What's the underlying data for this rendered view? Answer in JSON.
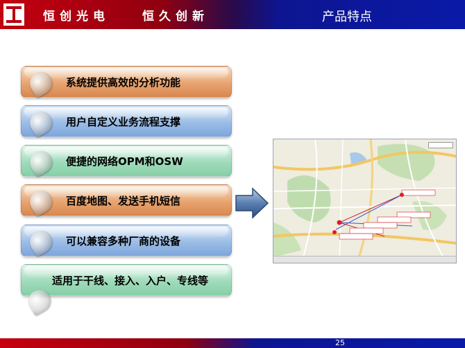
{
  "header": {
    "brand": "恒创光电",
    "slogan": "恒久创新",
    "title": "产品特点"
  },
  "features": [
    {
      "label": "系统提供高效的分析功能",
      "color": "orange"
    },
    {
      "label": "用户自定义业务流程支撑",
      "color": "blue"
    },
    {
      "label": "便捷的网络OPM和OSW",
      "color": "green"
    },
    {
      "label": "百度地图、发送手机短信",
      "color": "orange"
    },
    {
      "label": "可以兼容多种厂商的设备",
      "color": "blue"
    },
    {
      "label": "适用于干线、接入、入户、专线等",
      "color": "green"
    }
  ],
  "footer": {
    "page_number": "25"
  }
}
